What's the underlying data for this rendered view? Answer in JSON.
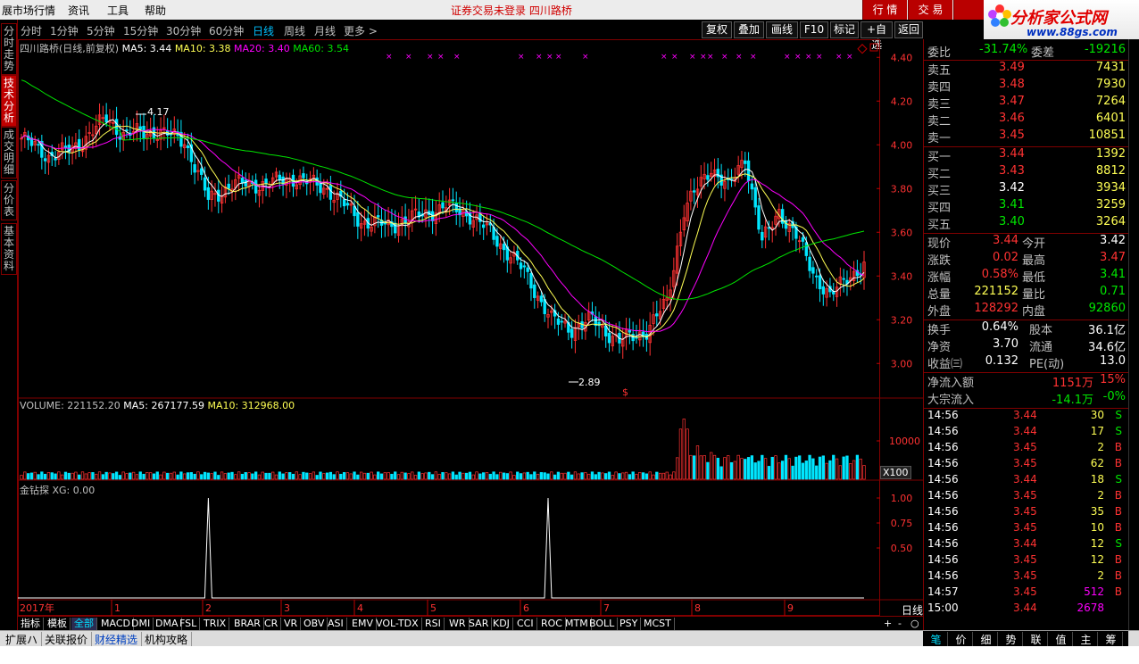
{
  "menu": {
    "items": [
      "展市场行情",
      "资讯",
      "工具",
      "帮助"
    ],
    "center_message": "证券交易未登录   四川路桥",
    "right_buttons": [
      "行 情",
      "交 易"
    ]
  },
  "logo": {
    "title": "分析家公式网",
    "url": "www.88gs.com"
  },
  "left_tabs": [
    "分时走势",
    "技术分析",
    "成交明细",
    "分价表",
    "基本资料"
  ],
  "periods": [
    "分时",
    "1分钟",
    "5分钟",
    "15分钟",
    "30分钟",
    "60分钟",
    "日线",
    "周线",
    "月线",
    "更多 >"
  ],
  "active_period": "日线",
  "toolbar_buttons": [
    "复权",
    "叠加",
    "画线",
    "F10",
    "标记",
    "+自选",
    "返回"
  ],
  "main_header": {
    "name": "四川路桥(日线,前复权)",
    "ma5": "MA5: 3.44",
    "ma10": "MA10: 3.38",
    "ma20": "MA20: 3.40",
    "ma60": "MA60: 3.54"
  },
  "price_axis": [
    "4.40",
    "4.20",
    "4.00",
    "3.80",
    "3.60",
    "3.40",
    "3.20",
    "3.00"
  ],
  "annotations": {
    "high": "4.17",
    "low": "2.89",
    "mark": "$"
  },
  "volume_header": {
    "label": "VOLUME: 221152.20",
    "ma5": "MA5: 267177.59",
    "ma10": "MA10: 312968.00"
  },
  "volume_axis": {
    "tick": "10000",
    "unit": "X100"
  },
  "indicator_header": "金钻探 XG: 0.00",
  "indicator_axis": [
    "1.00",
    "0.75",
    "0.50"
  ],
  "date_axis": {
    "labels": [
      "2017年",
      "1",
      "2",
      "3",
      "4",
      "5",
      "6",
      "7",
      "8",
      "9"
    ],
    "period_label": "日线"
  },
  "indicator_tabs": [
    "指标",
    "模板",
    "全部",
    "MACD",
    "DMI",
    "DMA",
    "FSL",
    "TRIX",
    "BRAR",
    "CR",
    "VR",
    "OBV",
    "ASI",
    "EMV",
    "VOL-TDX",
    "RSI",
    "WR",
    "SAR",
    "KDJ",
    "CCI",
    "ROC",
    "MTM",
    "BOLL",
    "PSY",
    "MCST"
  ],
  "indicator_nav": [
    "+",
    "-",
    "○"
  ],
  "bottom_tabs": [
    "扩展ハ",
    "关联报价",
    "财经精选",
    "机构攻略"
  ],
  "right_bottom_tabs": [
    "笔",
    "价",
    "细",
    "势",
    "联",
    "值",
    "主",
    "筹"
  ],
  "quote": {
    "weibi": {
      "label": "委比",
      "value": "-31.74%",
      "label2": "委差",
      "value2": "-19216"
    },
    "asks": [
      {
        "label": "卖五",
        "price": "3.49",
        "vol": "7431"
      },
      {
        "label": "卖四",
        "price": "3.48",
        "vol": "7930"
      },
      {
        "label": "卖三",
        "price": "3.47",
        "vol": "7264"
      },
      {
        "label": "卖二",
        "price": "3.46",
        "vol": "6401"
      },
      {
        "label": "卖一",
        "price": "3.45",
        "vol": "10851"
      }
    ],
    "bids": [
      {
        "label": "买一",
        "price": "3.44",
        "vol": "1392"
      },
      {
        "label": "买二",
        "price": "3.43",
        "vol": "8812"
      },
      {
        "label": "买三",
        "price": "3.42",
        "vol": "3934"
      },
      {
        "label": "买四",
        "price": "3.41",
        "vol": "3259"
      },
      {
        "label": "买五",
        "price": "3.40",
        "vol": "3264"
      }
    ],
    "stats": [
      {
        "l1": "现价",
        "v1": "3.44",
        "l2": "今开",
        "v2": "3.42"
      },
      {
        "l1": "涨跌",
        "v1": "0.02",
        "l2": "最高",
        "v2": "3.47"
      },
      {
        "l1": "涨幅",
        "v1": "0.58%",
        "l2": "最低",
        "v2": "3.41"
      },
      {
        "l1": "总量",
        "v1": "221152",
        "l2": "量比",
        "v2": "0.71"
      },
      {
        "l1": "外盘",
        "v1": "128292",
        "l2": "内盘",
        "v2": "92860"
      }
    ],
    "fundamentals": [
      {
        "l1": "换手",
        "v1": "0.64%",
        "l2": "股本",
        "v2": "36.1亿"
      },
      {
        "l1": "净资",
        "v1": "3.70",
        "l2": "流通",
        "v2": "34.6亿"
      },
      {
        "l1": "收益㈢",
        "v1": "0.132",
        "l2": "PE(动)",
        "v2": "13.0"
      }
    ],
    "flows": [
      {
        "label": "净流入额",
        "value": "1151万",
        "pct": "15%"
      },
      {
        "label": "大宗流入",
        "value": "-14.1万",
        "pct": "-0%"
      }
    ],
    "ticks": [
      {
        "time": "14:56",
        "price": "3.44",
        "vol": "30",
        "bs": "S"
      },
      {
        "time": "14:56",
        "price": "3.44",
        "vol": "17",
        "bs": "S"
      },
      {
        "time": "14:56",
        "price": "3.45",
        "vol": "2",
        "bs": "B"
      },
      {
        "time": "14:56",
        "price": "3.45",
        "vol": "62",
        "bs": "B"
      },
      {
        "time": "14:56",
        "price": "3.44",
        "vol": "18",
        "bs": "S"
      },
      {
        "time": "14:56",
        "price": "3.45",
        "vol": "2",
        "bs": "B"
      },
      {
        "time": "14:56",
        "price": "3.45",
        "vol": "35",
        "bs": "B"
      },
      {
        "time": "14:56",
        "price": "3.45",
        "vol": "10",
        "bs": "B"
      },
      {
        "time": "14:56",
        "price": "3.44",
        "vol": "12",
        "bs": "S"
      },
      {
        "time": "14:56",
        "price": "3.45",
        "vol": "12",
        "bs": "B"
      },
      {
        "time": "14:56",
        "price": "3.45",
        "vol": "2",
        "bs": "B"
      },
      {
        "time": "14:57",
        "price": "3.45",
        "vol": "512",
        "bs": "B"
      },
      {
        "time": "15:00",
        "price": "3.44",
        "vol": "2678",
        "bs": ""
      }
    ]
  },
  "colors": {
    "up": "#ff3232",
    "down": "#00e6ff",
    "ma5": "#ffffff",
    "ma10": "#ffff54",
    "ma20": "#ff00ff",
    "ma60": "#00e600",
    "frame": "#800000"
  },
  "chart_data": {
    "type": "candlestick",
    "ylim": [
      2.85,
      4.45
    ],
    "anchors": [
      [
        0,
        4.03
      ],
      [
        8,
        3.95
      ],
      [
        15,
        3.98
      ],
      [
        25,
        4.12
      ],
      [
        30,
        4.05
      ],
      [
        40,
        4.06
      ],
      [
        48,
        4.02
      ],
      [
        55,
        3.75
      ],
      [
        62,
        3.82
      ],
      [
        72,
        3.82
      ],
      [
        80,
        3.85
      ],
      [
        90,
        3.8
      ],
      [
        100,
        3.65
      ],
      [
        108,
        3.63
      ],
      [
        118,
        3.68
      ],
      [
        125,
        3.72
      ],
      [
        132,
        3.68
      ],
      [
        138,
        3.6
      ],
      [
        148,
        3.42
      ],
      [
        156,
        3.2
      ],
      [
        162,
        3.16
      ],
      [
        168,
        3.2
      ],
      [
        176,
        3.1
      ],
      [
        184,
        3.15
      ],
      [
        190,
        3.28
      ],
      [
        195,
        3.7
      ],
      [
        203,
        3.9
      ],
      [
        208,
        3.8
      ],
      [
        213,
        3.95
      ],
      [
        218,
        3.55
      ],
      [
        223,
        3.7
      ],
      [
        228,
        3.58
      ],
      [
        233,
        3.42
      ],
      [
        238,
        3.3
      ],
      [
        243,
        3.4
      ],
      [
        248,
        3.44
      ]
    ],
    "volume_spikes": [
      [
        195,
        9.0
      ],
      [
        199,
        5.0
      ],
      [
        203,
        4.0
      ],
      [
        208,
        3.5
      ],
      [
        213,
        3.0
      ]
    ],
    "indicator_signals": [
      55,
      155
    ]
  }
}
